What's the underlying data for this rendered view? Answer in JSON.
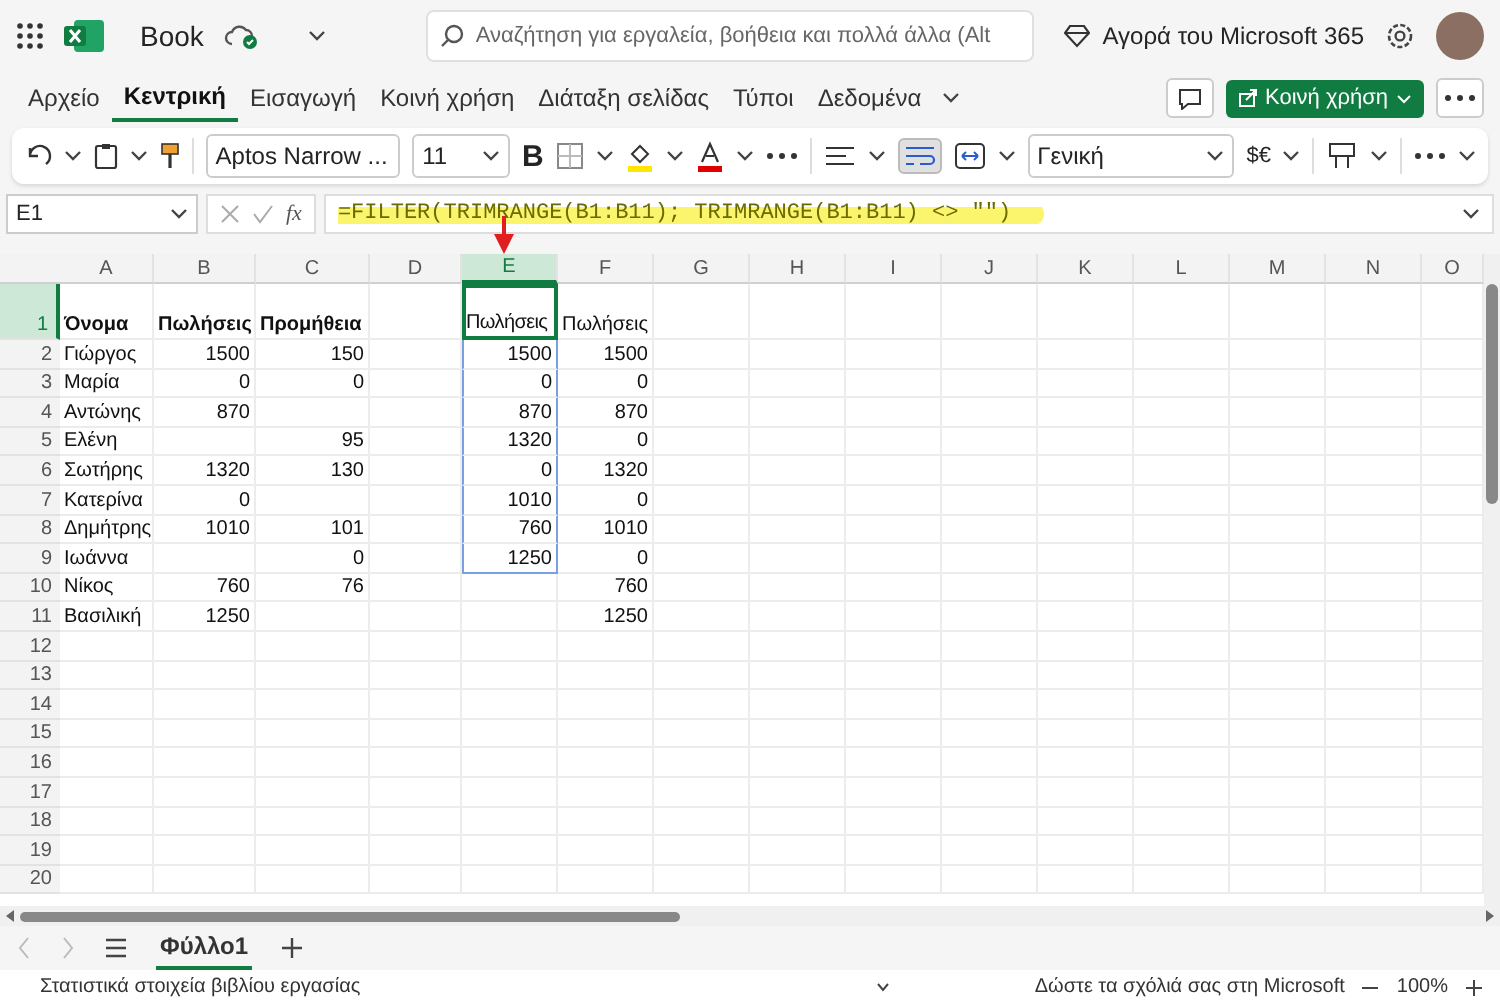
{
  "title_bar": {
    "document": "Book",
    "search": {
      "placeholder": "Αναζήτηση για εργαλεία, βοήθεια και πολλά άλλα (Alt"
    },
    "upgrade": "Αγορά του Microsoft 365"
  },
  "ribbon_tabs": [
    {
      "label": "Αρχείο",
      "selected": false
    },
    {
      "label": "Κεντρική",
      "selected": true
    },
    {
      "label": "Εισαγωγή",
      "selected": false
    },
    {
      "label": "Κοινή χρήση",
      "selected": false
    },
    {
      "label": "Διάταξη σελίδας",
      "selected": false
    },
    {
      "label": "Τύποι",
      "selected": false
    },
    {
      "label": "Δεδομένα",
      "selected": false
    }
  ],
  "share_button": "Κοινή χρήση",
  "toolbar": {
    "font": "Aptos Narrow ...",
    "size": "11",
    "bold": "B",
    "wrap_text_on": true,
    "number_format": "Γενική",
    "currency": "$€"
  },
  "formula_bar": {
    "name_box": "E1",
    "function_label": "fx",
    "formula": "=FILTER(TRIMRANGE(B1:B11); TRIMRANGE(B1:B11) <> \"\")"
  },
  "grid": {
    "columns": [
      {
        "label": "A",
        "selected": false
      },
      {
        "label": "B",
        "selected": false
      },
      {
        "label": "C",
        "selected": false
      },
      {
        "label": "D",
        "selected": false
      },
      {
        "label": "E",
        "selected": true
      },
      {
        "label": "F",
        "selected": false
      },
      {
        "label": "G",
        "selected": false
      },
      {
        "label": "H",
        "selected": false
      },
      {
        "label": "I",
        "selected": false
      },
      {
        "label": "J",
        "selected": false
      },
      {
        "label": "K",
        "selected": false
      },
      {
        "label": "L",
        "selected": false
      },
      {
        "label": "M",
        "selected": false
      },
      {
        "label": "N",
        "selected": false
      },
      {
        "label": "O",
        "selected": false
      }
    ],
    "rows": [
      {
        "label": "1",
        "selected": true,
        "cells": [
          {
            "text": "Όνομα",
            "kind": "header"
          },
          {
            "text": "Πωλήσεις",
            "kind": "header"
          },
          {
            "text": "Προμήθεια",
            "kind": "header"
          },
          null,
          {
            "text": "Πωλήσεις",
            "kind": "text",
            "selected": true,
            "spill": true
          },
          {
            "text": "Πωλήσεις",
            "kind": "text"
          }
        ]
      },
      {
        "label": "2",
        "selected": false,
        "cells": [
          {
            "text": "Γιώργος",
            "kind": "text"
          },
          {
            "text": "1500",
            "kind": "number"
          },
          {
            "text": "150",
            "kind": "number"
          },
          null,
          {
            "text": "1500",
            "kind": "number",
            "spill": true
          },
          {
            "text": "1500",
            "kind": "number"
          }
        ]
      },
      {
        "label": "3",
        "selected": false,
        "cells": [
          {
            "text": "Μαρία",
            "kind": "text"
          },
          {
            "text": "0",
            "kind": "number"
          },
          {
            "text": "0",
            "kind": "number"
          },
          null,
          {
            "text": "0",
            "kind": "number",
            "spill": true
          },
          {
            "text": "0",
            "kind": "number"
          }
        ]
      },
      {
        "label": "4",
        "selected": false,
        "cells": [
          {
            "text": "Αντώνης",
            "kind": "text"
          },
          {
            "text": "870",
            "kind": "number"
          },
          null,
          null,
          {
            "text": "870",
            "kind": "number",
            "spill": true
          },
          {
            "text": "870",
            "kind": "number"
          }
        ]
      },
      {
        "label": "5",
        "selected": false,
        "cells": [
          {
            "text": "Ελένη",
            "kind": "text"
          },
          null,
          {
            "text": "95",
            "kind": "number"
          },
          null,
          {
            "text": "1320",
            "kind": "number",
            "spill": true
          },
          {
            "text": "0",
            "kind": "number"
          }
        ]
      },
      {
        "label": "6",
        "selected": false,
        "cells": [
          {
            "text": "Σωτήρης",
            "kind": "text"
          },
          {
            "text": "1320",
            "kind": "number"
          },
          {
            "text": "130",
            "kind": "number"
          },
          null,
          {
            "text": "0",
            "kind": "number",
            "spill": true
          },
          {
            "text": "1320",
            "kind": "number"
          }
        ]
      },
      {
        "label": "7",
        "selected": false,
        "cells": [
          {
            "text": "Κατερίνα",
            "kind": "text"
          },
          {
            "text": "0",
            "kind": "number"
          },
          null,
          null,
          {
            "text": "1010",
            "kind": "number",
            "spill": true
          },
          {
            "text": "0",
            "kind": "number"
          }
        ]
      },
      {
        "label": "8",
        "selected": false,
        "cells": [
          {
            "text": "Δημήτρης",
            "kind": "text"
          },
          {
            "text": "1010",
            "kind": "number"
          },
          {
            "text": "101",
            "kind": "number"
          },
          null,
          {
            "text": "760",
            "kind": "number",
            "spill": true
          },
          {
            "text": "1010",
            "kind": "number"
          }
        ]
      },
      {
        "label": "9",
        "selected": false,
        "cells": [
          {
            "text": "Ιωάννα",
            "kind": "text"
          },
          null,
          {
            "text": "0",
            "kind": "number"
          },
          null,
          {
            "text": "1250",
            "kind": "number",
            "spill": true
          },
          {
            "text": "0",
            "kind": "number"
          }
        ]
      },
      {
        "label": "10",
        "selected": false,
        "cells": [
          {
            "text": "Νίκος",
            "kind": "text"
          },
          {
            "text": "760",
            "kind": "number"
          },
          {
            "text": "76",
            "kind": "number"
          },
          null,
          null,
          {
            "text": "760",
            "kind": "number"
          }
        ]
      },
      {
        "label": "11",
        "selected": false,
        "cells": [
          {
            "text": "Βασιλική",
            "kind": "text"
          },
          {
            "text": "1250",
            "kind": "number"
          },
          null,
          null,
          null,
          {
            "text": "1250",
            "kind": "number"
          }
        ]
      },
      {
        "label": "12",
        "selected": false,
        "cells": []
      },
      {
        "label": "13",
        "selected": false,
        "cells": []
      },
      {
        "label": "14",
        "selected": false,
        "cells": []
      },
      {
        "label": "15",
        "selected": false,
        "cells": []
      },
      {
        "label": "16",
        "selected": false,
        "cells": []
      },
      {
        "label": "17",
        "selected": false,
        "cells": []
      },
      {
        "label": "18",
        "selected": false,
        "cells": []
      },
      {
        "label": "19",
        "selected": false,
        "cells": []
      },
      {
        "label": "20",
        "selected": false,
        "cells": []
      }
    ]
  },
  "sheet_tabs": [
    {
      "label": "Φύλλο1",
      "selected": true
    }
  ],
  "status_bar": {
    "stats": "Στατιστικά στοιχεία βιβλίου εργασίας",
    "feedback": "Δώστε τα σχόλιά σας στη Microsoft",
    "zoom": "100%"
  }
}
